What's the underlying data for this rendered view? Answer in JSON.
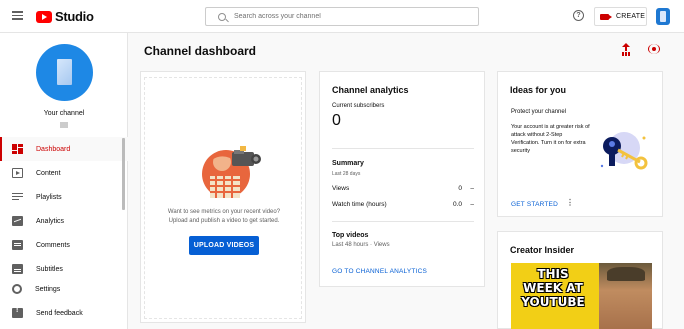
{
  "topbar": {
    "logo_text": "Studio",
    "search_placeholder": "Search across your channel",
    "help_glyph": "?",
    "create_label": "CREATE"
  },
  "sidebar": {
    "channel_label": "Your channel",
    "nav": [
      {
        "label": "Dashboard",
        "icon": "dashboard-icon",
        "active": true
      },
      {
        "label": "Content",
        "icon": "content-icon"
      },
      {
        "label": "Playlists",
        "icon": "playlists-icon"
      },
      {
        "label": "Analytics",
        "icon": "analytics-icon"
      },
      {
        "label": "Comments",
        "icon": "comments-icon"
      },
      {
        "label": "Subtitles",
        "icon": "subtitles-icon"
      }
    ],
    "bottom": [
      {
        "label": "Settings",
        "icon": "settings-icon"
      },
      {
        "label": "Send feedback",
        "icon": "feedback-icon"
      }
    ]
  },
  "main": {
    "title": "Channel dashboard",
    "upload_card": {
      "line1": "Want to see metrics on your recent video?",
      "line2": "Upload and publish a video to get started.",
      "button": "UPLOAD VIDEOS"
    },
    "analytics": {
      "title": "Channel analytics",
      "subscribers_label": "Current subscribers",
      "subscribers_value": "0",
      "summary_title": "Summary",
      "summary_sub": "Last 28 days",
      "rows": [
        {
          "label": "Views",
          "value": "0",
          "trend": "–"
        },
        {
          "label": "Watch time (hours)",
          "value": "0.0",
          "trend": "–"
        }
      ],
      "top_title": "Top videos",
      "top_sub": "Last 48 hours · Views",
      "link": "GO TO CHANNEL ANALYTICS"
    },
    "ideas": {
      "title": "Ideas for you",
      "headline": "Protect your channel",
      "body": "Your account is at greater risk of attack without 2-Step Verification. Turn it on for extra security",
      "link": "GET STARTED",
      "more": "⋮"
    },
    "insider": {
      "title": "Creator Insider",
      "thumb_text": "THIS WEEK AT YOUTUBE"
    }
  },
  "colors": {
    "accent_red": "#cc0000",
    "link_blue": "#065fd4"
  }
}
